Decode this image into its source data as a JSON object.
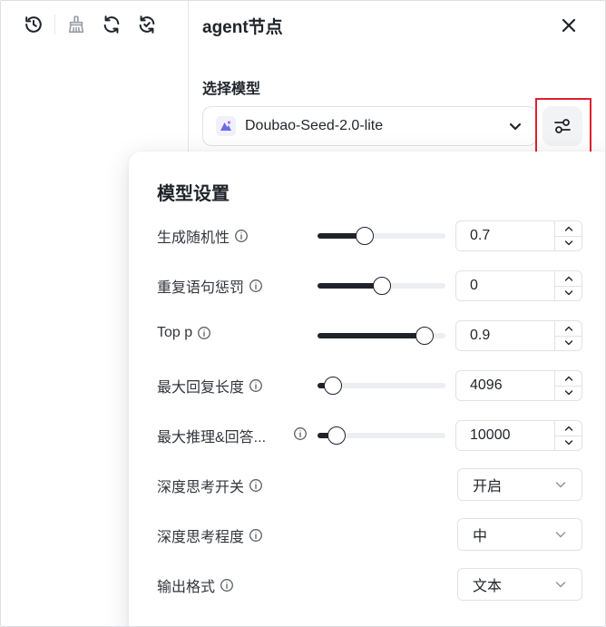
{
  "panel": {
    "title": "agent节点",
    "model_section_label": "选择模型",
    "model_selected": "Doubao-Seed-2.0-lite"
  },
  "settings": {
    "title": "模型设置",
    "params": [
      {
        "label": "生成随机性",
        "value": "0.7",
        "level": 0.37
      },
      {
        "label": "重复语句惩罚",
        "value": "0",
        "level": 0.5
      },
      {
        "label": "Top p",
        "value": "0.9",
        "level": 0.84
      },
      {
        "label": "最大回复长度",
        "value": "4096",
        "level": 0.12
      },
      {
        "label": "最大推理&回答...",
        "value": "10000",
        "level": 0.15
      }
    ],
    "selects": [
      {
        "label": "深度思考开关",
        "value": "开启"
      },
      {
        "label": "深度思考程度",
        "value": "中"
      },
      {
        "label": "输出格式",
        "value": "文本"
      }
    ]
  },
  "colors": {
    "highlight": "#e0202e",
    "slider_fill": "#1f2329"
  }
}
